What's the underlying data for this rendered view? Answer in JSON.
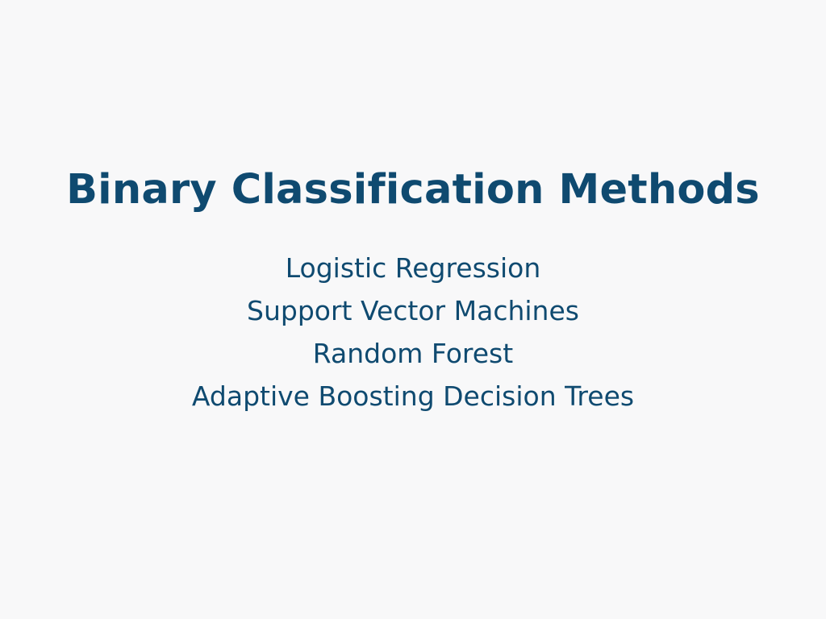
{
  "slide": {
    "title": "Binary Classification Methods",
    "methods": [
      "Logistic Regression",
      "Support Vector Machines",
      "Random Forest",
      "Adaptive Boosting Decision Trees"
    ]
  },
  "colors": {
    "background": "#f8f8f9",
    "text": "#0f4a70"
  }
}
